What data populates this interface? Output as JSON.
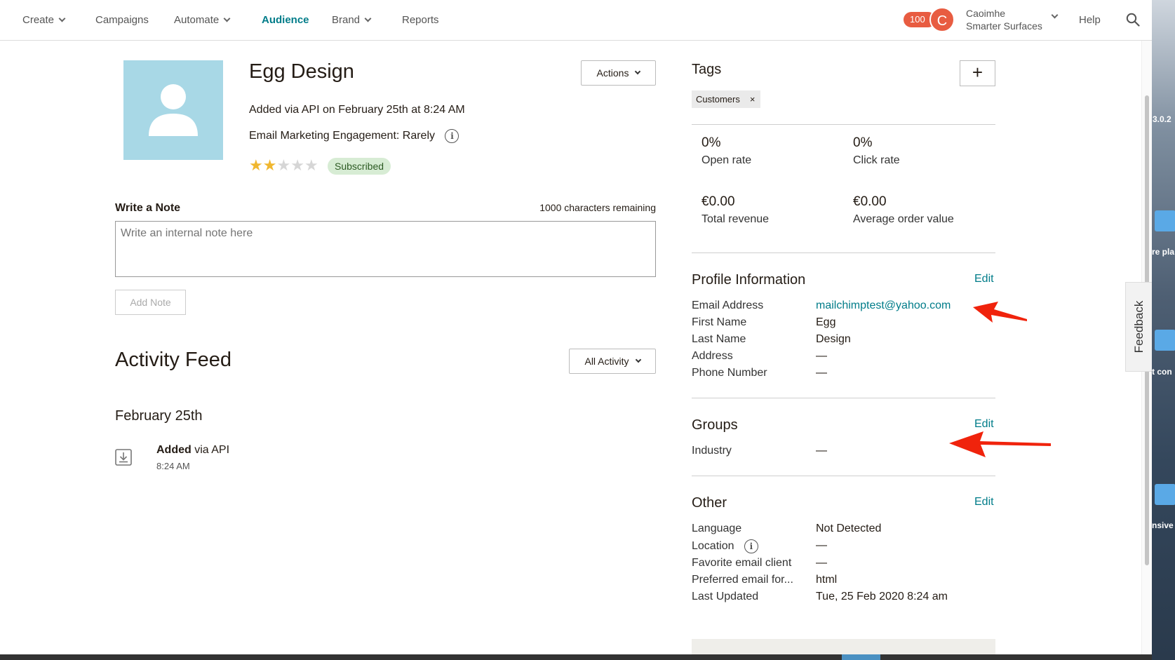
{
  "nav": {
    "items": [
      {
        "label": "Create",
        "has_menu": true
      },
      {
        "label": "Campaigns",
        "has_menu": false
      },
      {
        "label": "Automate",
        "has_menu": true
      },
      {
        "label": "Audience",
        "has_menu": false,
        "active": true
      },
      {
        "label": "Brand",
        "has_menu": true
      },
      {
        "label": "Reports",
        "has_menu": false
      }
    ],
    "notification_count": "100",
    "avatar_initial": "C",
    "account_user": "Caoimhe",
    "account_org": "Smarter Surfaces",
    "help_label": "Help",
    "search_icon": "search-icon",
    "accent_color": "#007c89",
    "badge_color": "#e85c41"
  },
  "contact": {
    "name": "Egg Design",
    "added_text": "Added via API on February 25th at 8:24 AM",
    "engagement_text": "Email Marketing Engagement: Rarely",
    "rating": 2,
    "rating_max": 5,
    "status_badge": "Subscribed",
    "actions_label": "Actions"
  },
  "note": {
    "label": "Write a Note",
    "chars_remaining": "1000 characters remaining",
    "placeholder": "Write an internal note here",
    "add_button": "Add Note"
  },
  "activity": {
    "title": "Activity Feed",
    "filter_label": "All Activity",
    "date_heading": "February 25th",
    "event_strong": "Added",
    "event_rest": " via API",
    "event_time": "8:24 AM"
  },
  "tags": {
    "title": "Tags",
    "add_label": "+",
    "items": [
      {
        "label": "Customers",
        "remove": "×"
      }
    ]
  },
  "stats": {
    "open_rate": {
      "value": "0%",
      "label": "Open rate"
    },
    "click_rate": {
      "value": "0%",
      "label": "Click rate"
    },
    "total_revenue": {
      "value": "€0.00",
      "label": "Total revenue"
    },
    "avg_order": {
      "value": "€0.00",
      "label": "Average order value"
    }
  },
  "profile": {
    "title": "Profile Information",
    "edit": "Edit",
    "rows": [
      {
        "label": "Email Address",
        "value": "mailchimptest@yahoo.com"
      },
      {
        "label": "First Name",
        "value": "Egg"
      },
      {
        "label": "Last Name",
        "value": "Design"
      },
      {
        "label": "Address",
        "value": "—"
      },
      {
        "label": "Phone Number",
        "value": "—"
      }
    ]
  },
  "groups": {
    "title": "Groups",
    "edit": "Edit",
    "rows": [
      {
        "label": "Industry",
        "value": "—"
      }
    ]
  },
  "other": {
    "title": "Other",
    "edit": "Edit",
    "rows": [
      {
        "label": "Language",
        "value": "Not Detected"
      },
      {
        "label": "Location",
        "value": "—"
      },
      {
        "label": "Favorite email client",
        "value": "—"
      },
      {
        "label": "Preferred email for...",
        "value": "html"
      },
      {
        "label": "Last Updated",
        "value": "Tue, 25 Feb 2020 8:24 am"
      }
    ]
  },
  "feedback_label": "Feedback",
  "desktop_fragments": [
    "3.0.2",
    "re pla",
    "t con",
    "nsive"
  ],
  "annotation_color": "#f0230c"
}
